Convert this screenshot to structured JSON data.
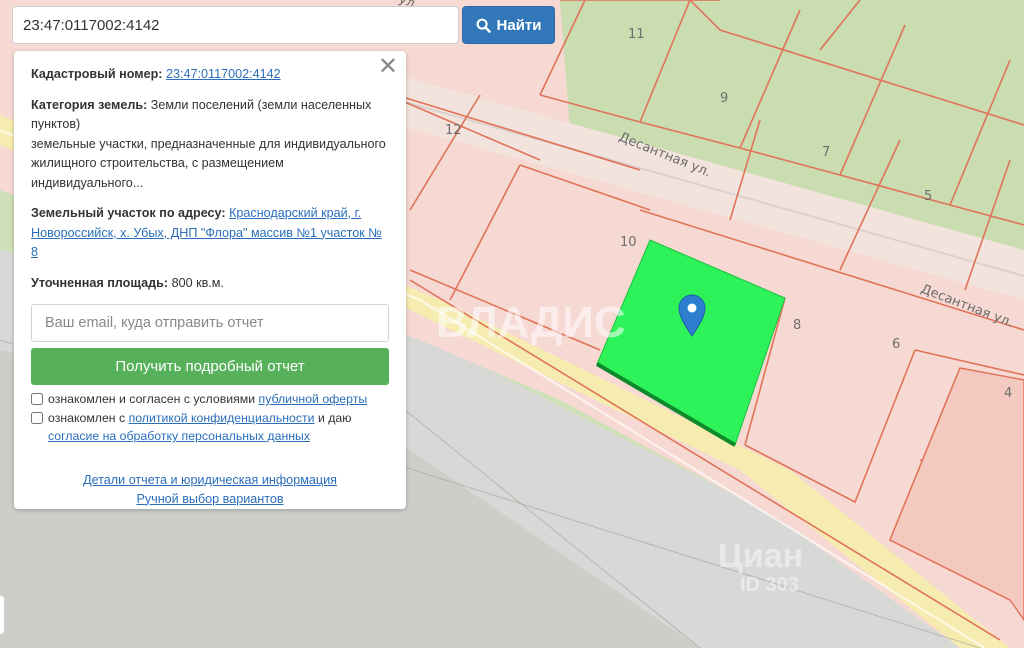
{
  "search": {
    "value": "23:47:0117002:4142",
    "button_label": "Найти",
    "button_icon": "search-icon"
  },
  "panel": {
    "cadastral_label": "Кадастровый номер:",
    "cadastral_value": "23:47:0117002:4142",
    "category_label": "Категория земель:",
    "category_value": "Земли поселений (земли населенных пунктов)",
    "category_desc": "земельные участки, предназначенные для индивидуального жилищного строительства, с размещением индивидуального...",
    "address_label": "Земельный участок по адресу:",
    "address_value": "Краснодарский край, г. Новороссийск, х. Убых, ДНП \"Флора\" массив №1 участок № 8",
    "area_label": "Уточненная площадь:",
    "area_value": "800 кв.м.",
    "email_placeholder": "Ваш email, куда отправить отчет",
    "get_report_label": "Получить подробный отчет",
    "consent1_text": "ознакомлен и согласен с условиями",
    "consent1_link": "публичной оферты",
    "consent2_text1": "ознакомлен с",
    "consent2_link1": "политикой конфиденциальности",
    "consent2_text2": "и даю",
    "consent2_link2": "согласие на обработку персональных данных",
    "details_link": "Детали отчета и юридическая информация",
    "manual_link": "Ручной выбор вариантов",
    "close_icon": "close-icon"
  },
  "map": {
    "plot_numbers": [
      "11",
      "9",
      "7",
      "5",
      "12",
      "10",
      "8",
      "6",
      "4"
    ],
    "street_name": "Десантная ул.",
    "street_name_2": "Десантная ул.",
    "partial_label": "ул",
    "watermark_vladis": "ВЛАДИС",
    "watermark_cian": "Циан",
    "watermark_id": "ID 303",
    "marker_icon": "map-pin-icon",
    "colors": {
      "selected_plot": "#2ef25a",
      "plot_fill": "#f7d9d3",
      "plot_border": "#e07358",
      "road": "#f6ecb0",
      "green_area": "#cfe0b9",
      "marker": "#2f7fd0"
    }
  }
}
